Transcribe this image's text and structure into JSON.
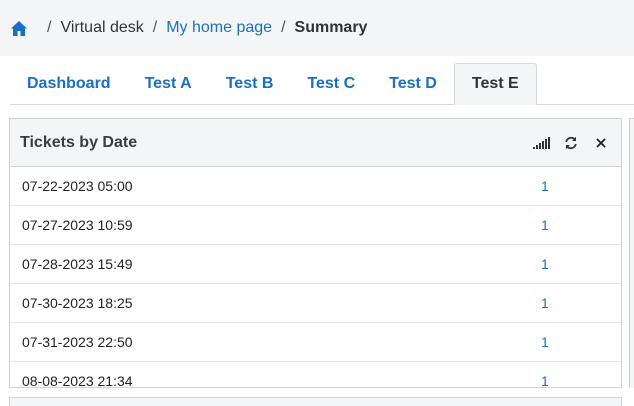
{
  "breadcrumb": {
    "home_icon": "home-icon",
    "items": [
      "Virtual desk",
      "My home page",
      "Summary"
    ],
    "separator": "/"
  },
  "tabs": [
    "Dashboard",
    "Test A",
    "Test B",
    "Test C",
    "Test D",
    "Test E"
  ],
  "active_tab": "Test E",
  "widget": {
    "title": "Tickets by Date",
    "icons": [
      "signal-bars-icon",
      "refresh-icon",
      "close-icon"
    ],
    "rows": [
      {
        "date": "07-22-2023 05:00",
        "count": "1"
      },
      {
        "date": "07-27-2023 10:59",
        "count": "1"
      },
      {
        "date": "07-28-2023 15:49",
        "count": "1"
      },
      {
        "date": "07-30-2023 18:25",
        "count": "1"
      },
      {
        "date": "07-31-2023 22:50",
        "count": "1"
      },
      {
        "date": "08-08-2023 21:34",
        "count": "1"
      }
    ]
  },
  "colors": {
    "link": "#1a6fc4",
    "header_bg": "#f4f5f7",
    "border": "#cfd2d6"
  }
}
